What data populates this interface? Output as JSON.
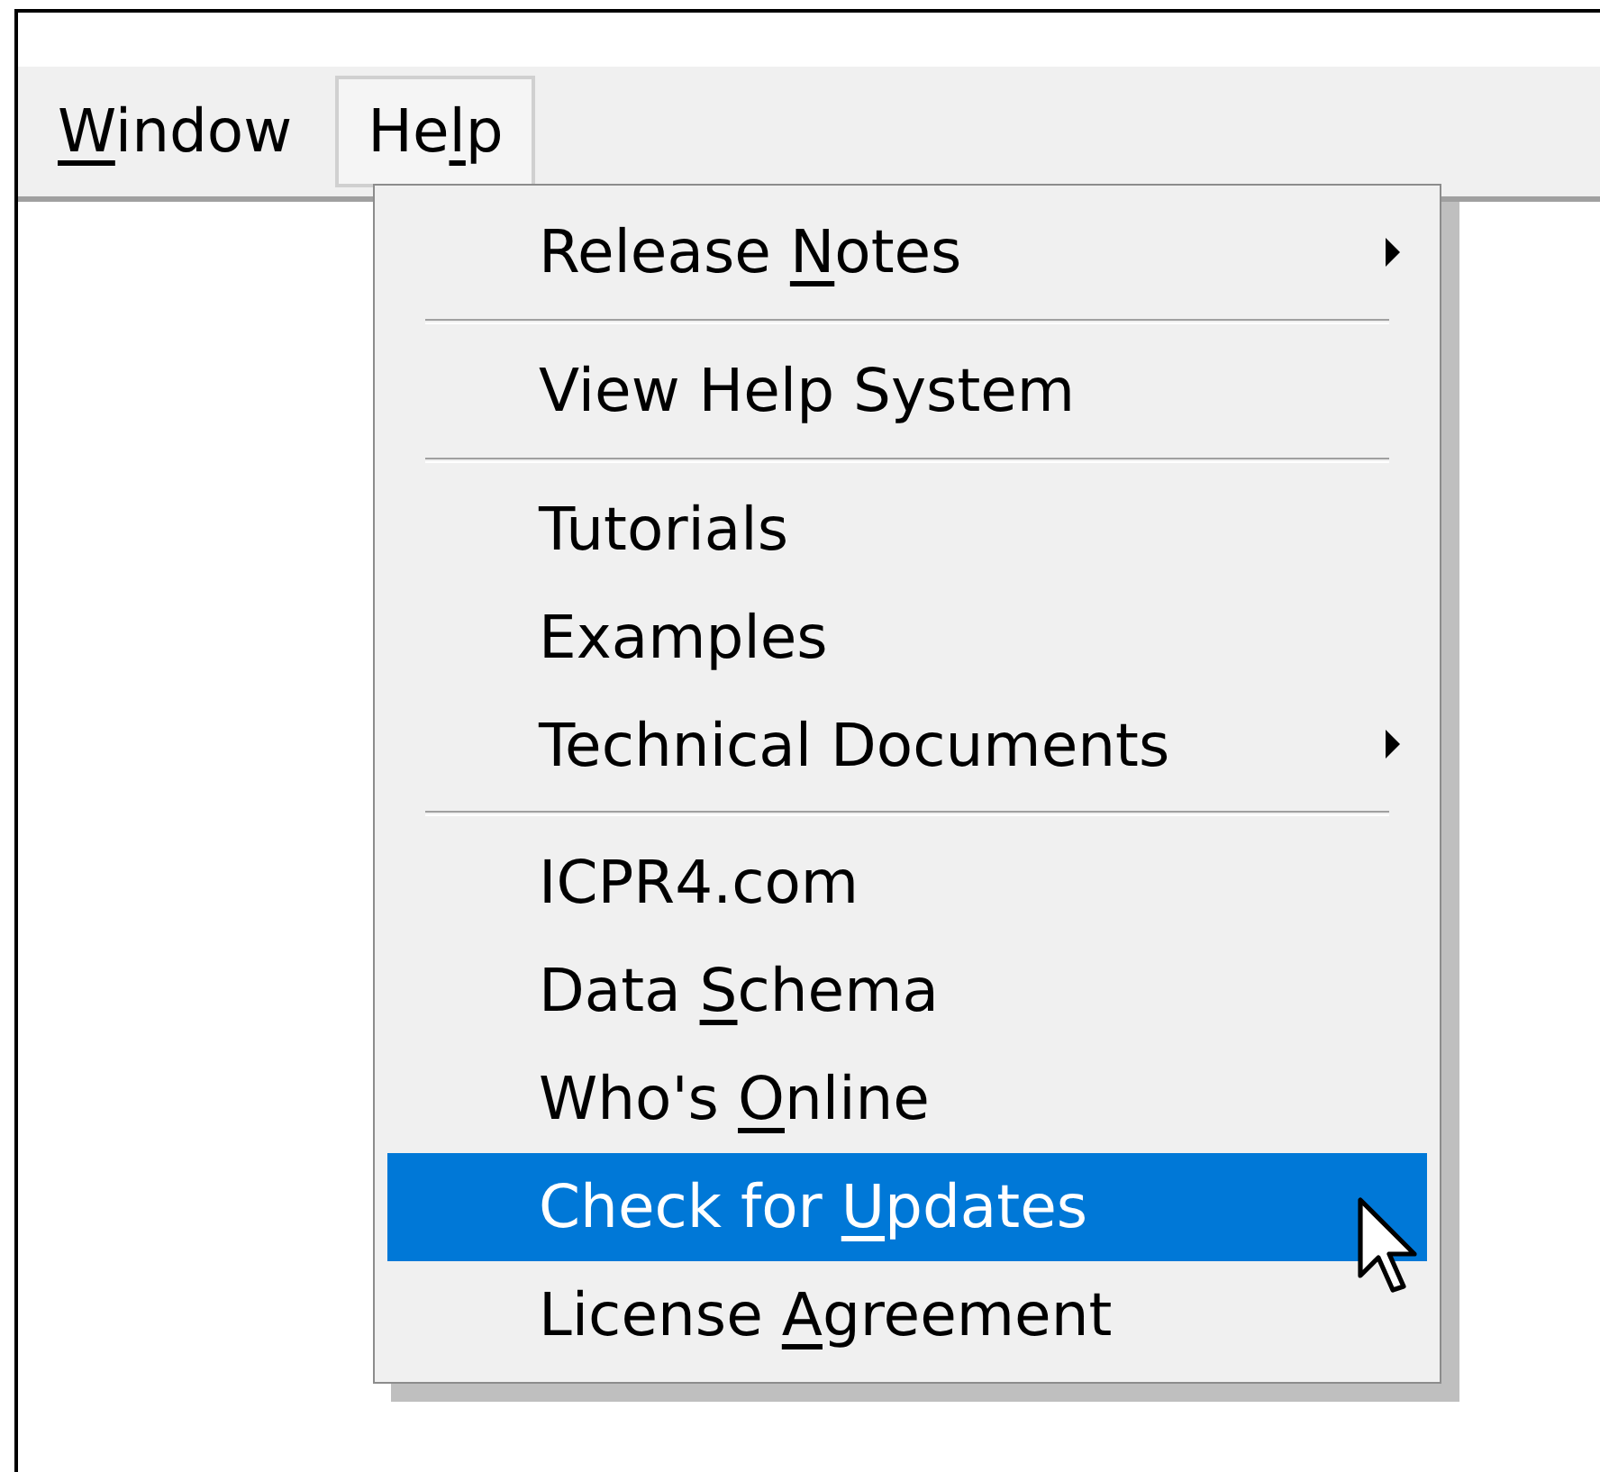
{
  "menubar": [
    {
      "label_parts": [
        {
          "text": "W",
          "underlined": true
        },
        {
          "text": "indow",
          "underlined": false
        }
      ],
      "selected": false
    },
    {
      "label_parts": [
        {
          "text": "He",
          "underlined": false
        },
        {
          "text": "l",
          "underlined": true
        },
        {
          "text": "p",
          "underlined": false
        }
      ],
      "selected": true
    }
  ],
  "menu": [
    {
      "kind": "item",
      "label_parts": [
        {
          "text": "Release ",
          "underlined": false
        },
        {
          "text": "N",
          "underlined": true
        },
        {
          "text": "otes",
          "underlined": false
        }
      ],
      "submenu": true,
      "selected": false
    },
    {
      "kind": "separator"
    },
    {
      "kind": "item",
      "label_parts": [
        {
          "text": "View Help System",
          "underlined": false
        }
      ],
      "submenu": false,
      "selected": false
    },
    {
      "kind": "separator"
    },
    {
      "kind": "item",
      "label_parts": [
        {
          "text": "Tutorials",
          "underlined": false
        }
      ],
      "submenu": false,
      "selected": false
    },
    {
      "kind": "item",
      "label_parts": [
        {
          "text": "Examples",
          "underlined": false
        }
      ],
      "submenu": false,
      "selected": false
    },
    {
      "kind": "item",
      "label_parts": [
        {
          "text": "Technical Documents",
          "underlined": false
        }
      ],
      "submenu": true,
      "selected": false
    },
    {
      "kind": "separator"
    },
    {
      "kind": "item",
      "label_parts": [
        {
          "text": "ICPR4.com",
          "underlined": false
        }
      ],
      "submenu": false,
      "selected": false
    },
    {
      "kind": "item",
      "label_parts": [
        {
          "text": "Data ",
          "underlined": false
        },
        {
          "text": "S",
          "underlined": true
        },
        {
          "text": "chema",
          "underlined": false
        }
      ],
      "submenu": false,
      "selected": false
    },
    {
      "kind": "item",
      "label_parts": [
        {
          "text": "Who's ",
          "underlined": false
        },
        {
          "text": "O",
          "underlined": true
        },
        {
          "text": "nline",
          "underlined": false
        }
      ],
      "submenu": false,
      "selected": false
    },
    {
      "kind": "item",
      "label_parts": [
        {
          "text": "Check for ",
          "underlined": false
        },
        {
          "text": "U",
          "underlined": true
        },
        {
          "text": "pdates",
          "underlined": false
        }
      ],
      "submenu": false,
      "selected": true
    },
    {
      "kind": "item",
      "label_parts": [
        {
          "text": "License ",
          "underlined": false
        },
        {
          "text": "A",
          "underlined": true
        },
        {
          "text": "greement",
          "underlined": false
        }
      ],
      "submenu": false,
      "selected": false
    }
  ]
}
